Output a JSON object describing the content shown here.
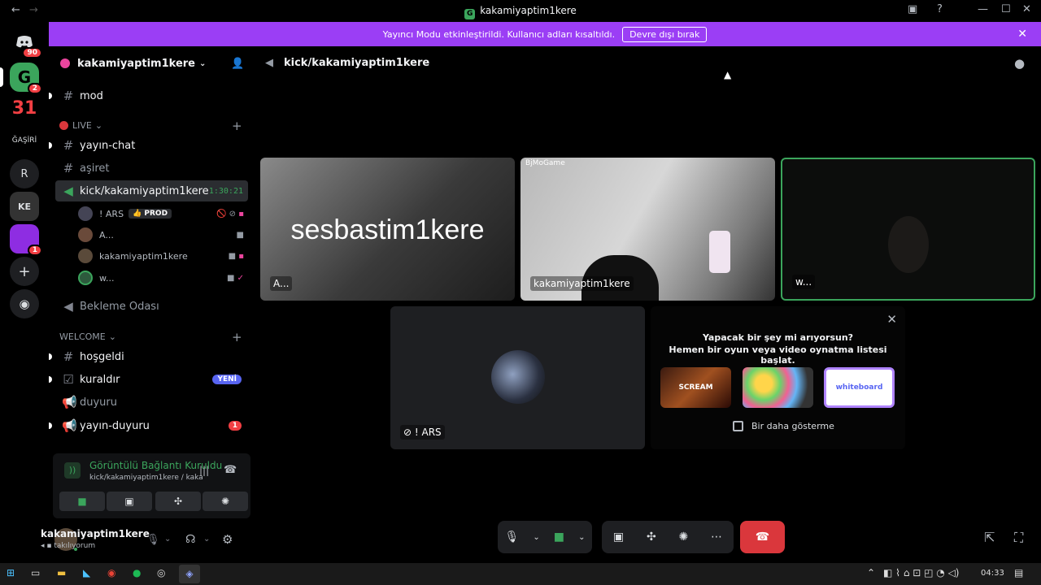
{
  "window": {
    "title": "kakamiyaptim1kere",
    "nav_back": "←",
    "nav_forward": "→"
  },
  "banner": {
    "text": "Yayıncı Modu etkinleştirildi. Kullanıcı adları kısaltıldı.",
    "button": "Devre dışı bırak",
    "close": "✕"
  },
  "rail": {
    "servers": [
      {
        "label": "",
        "badge": "90",
        "icon": "discord-icon"
      },
      {
        "label": "G",
        "badge": "2",
        "icon": "green-server-icon"
      },
      {
        "label": "31",
        "badge": "",
        "icon": "server-31-icon"
      },
      {
        "label": "ĞAŞİRİ",
        "badge": "",
        "icon": "server-asiri-icon"
      },
      {
        "label": "R",
        "badge": "",
        "icon": "server-r-icon"
      },
      {
        "label": "KE",
        "badge": "",
        "icon": "server-ke-icon"
      },
      {
        "label": "",
        "badge": "1",
        "icon": "purple-server-icon"
      },
      {
        "label": "+",
        "badge": "",
        "icon": "add-server-icon"
      },
      {
        "label": "◉",
        "badge": "",
        "icon": "explore-icon"
      }
    ]
  },
  "server": {
    "name": "kakamiyaptim1kere",
    "channels": {
      "mod": "mod",
      "live_category": "LIVE",
      "yayin_chat": "yayın-chat",
      "asiret": "aşiret",
      "voice_active": "kick/kakamiyaptim1kere",
      "voice_timer": "1:30:21",
      "bekleme": "Bekleme Odası",
      "welcome_category": "WELCOME",
      "hosgeldi": "hoşgeldi",
      "kuraldir": "kuraldır",
      "kuraldir_badge": "YENİ",
      "duyuru": "duyuru",
      "yayin_duyuru": "yayın-duyuru",
      "yayin_duyuru_badge": "1"
    },
    "voice_users": [
      {
        "name": "! ARS",
        "tag": "👍 PROD"
      },
      {
        "name": "A...",
        "tag": ""
      },
      {
        "name": "kakamiyaptim1kere",
        "tag": ""
      },
      {
        "name": "w...",
        "tag": ""
      }
    ]
  },
  "voice_panel": {
    "status": "Görüntülü Bağlantı Kuruldu",
    "channel": "kick/kakamiyaptim1kere / kakamiyaptim..."
  },
  "user_panel": {
    "name": "kakamiyaptim1kere",
    "status": "takılıyorum"
  },
  "main": {
    "header_channel": "kick/kakamiyaptim1kere",
    "tiles": [
      {
        "name": "A...",
        "overlay_text": "sesbastim1kere"
      },
      {
        "name": "kakamiyaptim1kere",
        "overlay_text": "BjMoGame"
      },
      {
        "name": "w...",
        "overlay_text": ""
      },
      {
        "name": "! ARS",
        "overlay_text": ""
      }
    ],
    "activity": {
      "line1": "Yapacak bir şey mi arıyorsun?",
      "line2": "Hemen bir oyun veya video oynatma listesi başlat.",
      "games": [
        "SCREAM",
        "",
        "whiteboard"
      ],
      "checkbox_label": "Bir daha gösterme"
    }
  },
  "taskbar": {
    "time": "04:33"
  },
  "colors": {
    "banner": "#9b3ef5",
    "active_speaker": "#3ba55c",
    "end_call": "#da373c",
    "new_badge": "#5865f2",
    "notif": "#f23f43"
  }
}
